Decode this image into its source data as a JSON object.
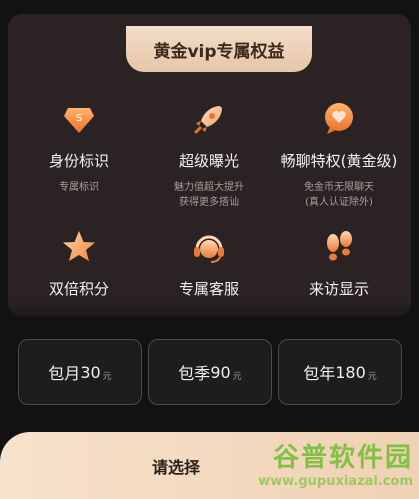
{
  "header": {
    "title": "黄金vip专属权益"
  },
  "benefits": [
    {
      "title": "身份标识",
      "desc1": "专属标识",
      "desc2": "",
      "icon": "badge-s-icon"
    },
    {
      "title": "超级曝光",
      "desc1": "魅力值超大提升",
      "desc2": "获得更多搭讪",
      "icon": "rocket-icon"
    },
    {
      "title": "畅聊特权(黄金级)",
      "desc1": "免金币无限聊天",
      "desc2": "(真人认证除外)",
      "icon": "heart-chat-icon"
    },
    {
      "title": "双倍积分",
      "desc1": "",
      "desc2": "",
      "icon": "star-icon"
    },
    {
      "title": "专属客服",
      "desc1": "",
      "desc2": "",
      "icon": "headset-icon"
    },
    {
      "title": "来访显示",
      "desc1": "",
      "desc2": "",
      "icon": "footprints-icon"
    }
  ],
  "plans": [
    {
      "name": "包月",
      "price": "30",
      "unit": "元"
    },
    {
      "name": "包季",
      "price": "90",
      "unit": "元"
    },
    {
      "name": "包年",
      "price": "180",
      "unit": "元"
    }
  ],
  "cta": {
    "label": "请选择"
  },
  "watermark": {
    "brand": "谷普软件园",
    "url": "www.gupuxiazai.com"
  },
  "colors": {
    "gold": "#e6c6a8",
    "panel": "#2b2223",
    "icon_orange": "#f08a3c"
  }
}
